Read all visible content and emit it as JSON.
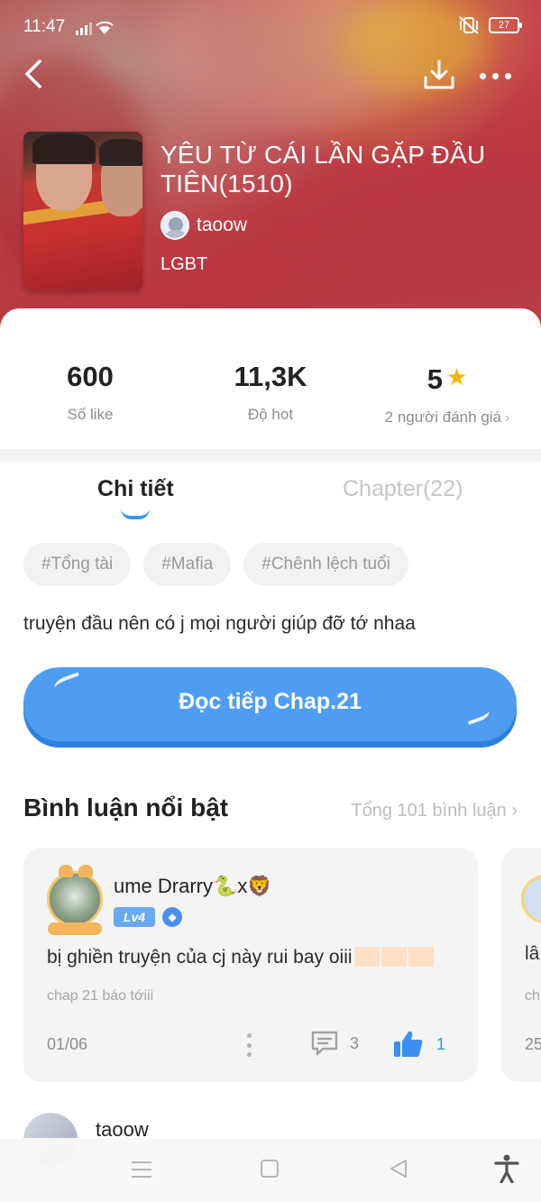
{
  "status_bar": {
    "time": "11:47",
    "battery": "27"
  },
  "header": {
    "title": "YÊU TỪ CÁI LẦN GẶP ĐẦU TIÊN(1510)",
    "author": "taoow",
    "genre": "LGBT"
  },
  "stats": {
    "likes": {
      "value": "600",
      "label": "Số like"
    },
    "hot": {
      "value": "11,3K",
      "label": "Độ hot"
    },
    "rating": {
      "value": "5",
      "label": "2 người đánh giá"
    }
  },
  "tabs": [
    {
      "label": "Chi tiết",
      "active": true
    },
    {
      "label": "Chapter(22)",
      "active": false
    }
  ],
  "tags": [
    "#Tổng tài",
    "#Mafia",
    "#Chênh lệch tuổi"
  ],
  "description": "truyện đầu nên có j mọi người giúp đỡ tớ nhaa",
  "read_button": "Đọc tiếp Chap.21",
  "comments": {
    "heading": "Bình luận nổi bật",
    "total": "Tổng 101 bình luận",
    "items": [
      {
        "user": "ume Drarry🐍x🦁",
        "level": "Lv4",
        "text": "bị ghiền truyện của cj này rui bay oiii",
        "sub": "chap 21 báo tớiii",
        "date": "01/06",
        "replies": "3",
        "likes": "1"
      },
      {
        "text": "lâ",
        "sub": "ch",
        "date": "25"
      }
    ],
    "next_user": "taoow"
  },
  "colors": {
    "accent": "#4f9df2",
    "star": "#f7b500",
    "hero_red": "#cc3a44"
  }
}
